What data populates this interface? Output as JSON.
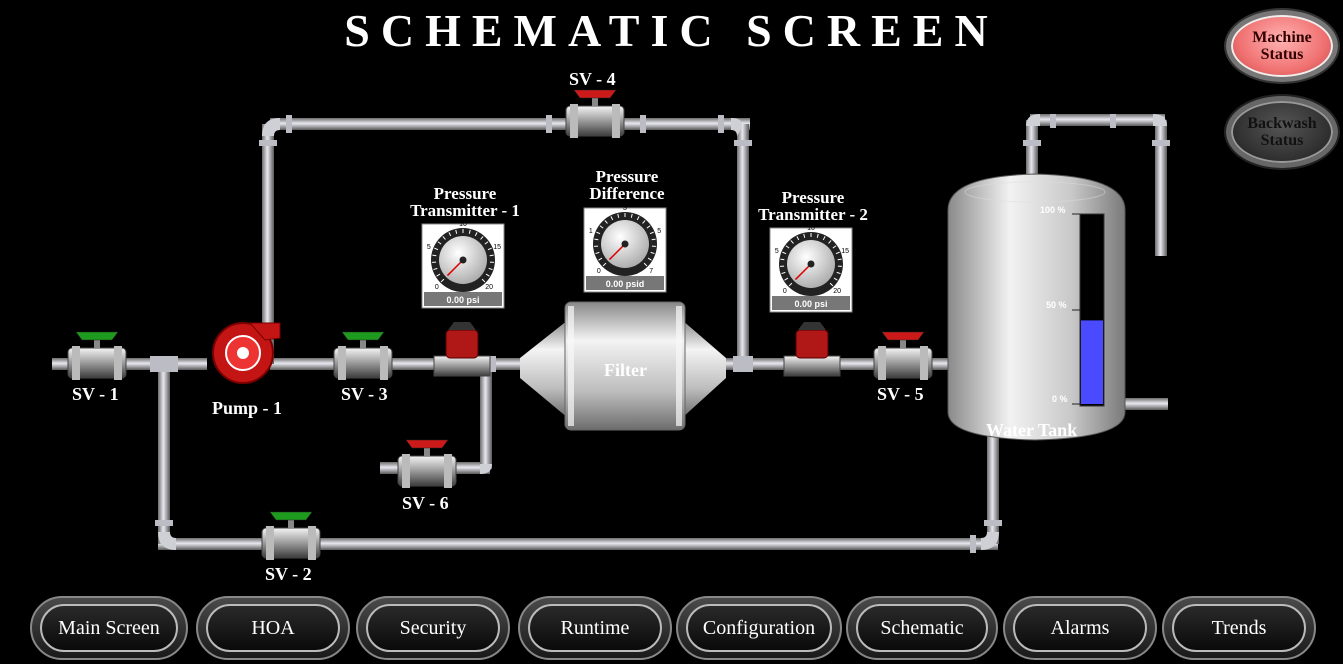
{
  "title": "SCHEMATIC SCREEN",
  "status_buttons": {
    "machine": {
      "label_line1": "Machine",
      "label_line2": "Status"
    },
    "backwash": {
      "label_line1": "Backwash",
      "label_line2": "Status"
    }
  },
  "valves": {
    "sv1": "SV - 1",
    "sv2": "SV - 2",
    "sv3": "SV - 3",
    "sv4": "SV - 4",
    "sv5": "SV - 5",
    "sv6": "SV - 6"
  },
  "pump": {
    "label": "Pump - 1"
  },
  "filter": {
    "label": "Filter"
  },
  "pt1": {
    "title_line1": "Pressure",
    "title_line2": "Transmitter - 1",
    "reading": "0.00 psi",
    "ticks": [
      "0",
      "5",
      "10",
      "15",
      "20"
    ]
  },
  "pt2": {
    "title_line1": "Pressure",
    "title_line2": "Transmitter - 2",
    "reading": "0.00 psi",
    "ticks": [
      "0",
      "5",
      "10",
      "15",
      "20"
    ]
  },
  "pdiff": {
    "title_line1": "Pressure",
    "title_line2": "Difference",
    "reading": "0.00 psid",
    "ticks": [
      "0",
      "1",
      "3",
      "5",
      "7"
    ]
  },
  "tank": {
    "label": "Water Tank",
    "scale": [
      "100 %",
      "50 %",
      "0 %"
    ],
    "level_percent": 44
  },
  "nav": [
    "Main Screen",
    "HOA",
    "Security",
    "Runtime",
    "Configuration",
    "Schematic",
    "Alarms",
    "Trends"
  ],
  "colors": {
    "valve_open": "#1e9a1e",
    "valve_closed": "#cc1a1a",
    "pump": "#cc1111",
    "tank_level": "#4a4aff",
    "active_status": "#f07070"
  }
}
